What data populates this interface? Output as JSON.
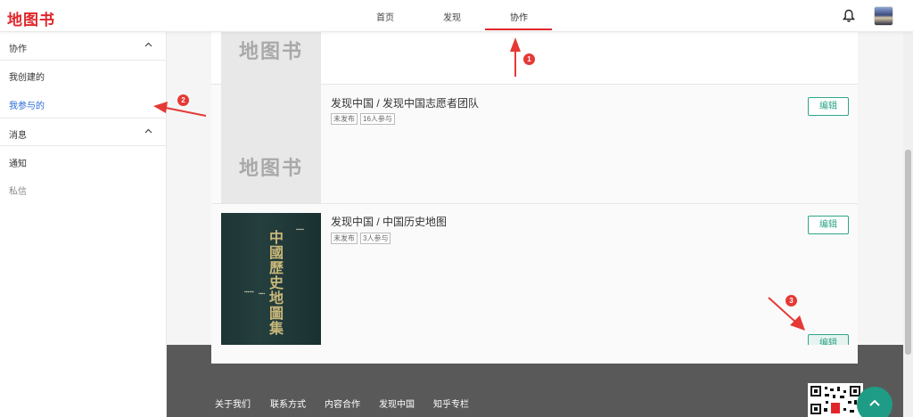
{
  "header": {
    "logo": "地图书",
    "nav": [
      "首页",
      "发现",
      "协作"
    ],
    "active_nav": "协作",
    "bell_icon": "bell-icon",
    "avatar": "user-avatar"
  },
  "sidebar": {
    "sections": [
      {
        "title": "协作",
        "items": [
          "我创建的",
          "我参与的"
        ]
      },
      {
        "title": "消息",
        "items": [
          "通知",
          "私信"
        ]
      }
    ],
    "active_item": "我参与的"
  },
  "cards": [
    {
      "thumb_placeholder": "地图书"
    },
    {
      "thumb_placeholder": "地图书",
      "title": "发现中国 / 发现中国志愿者团队",
      "tags": [
        "未发布",
        "16人参与"
      ],
      "edit_label": "编辑"
    },
    {
      "title": "发现中国 / 中国历史地图",
      "tags": [
        "未发布",
        "3人参与"
      ],
      "edit_label": "编辑",
      "cover_title": "中國歷史地圖集"
    }
  ],
  "extra_edit_label": "编辑",
  "footer": {
    "links": [
      "关于我们",
      "联系方式",
      "内容合作",
      "发现中国",
      "知乎专栏"
    ]
  },
  "annotations": {
    "badges": [
      "1",
      "2",
      "3"
    ],
    "color": "#e53935"
  },
  "colors": {
    "brand": "#e0262b",
    "accent": "#2ea58a",
    "active_link": "#2a6bd8",
    "footer_bg": "#595959"
  }
}
